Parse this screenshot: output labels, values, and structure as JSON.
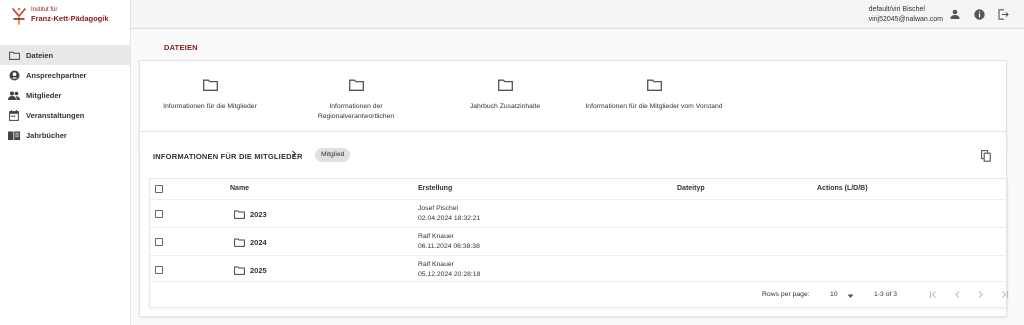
{
  "brand": {
    "line1": "Institut für",
    "line2": "Franz-Kett-Pädagogik"
  },
  "sidebar": {
    "items": [
      {
        "label": "Dateien",
        "icon": "folder-icon",
        "active": true
      },
      {
        "label": "Ansprechpartner",
        "icon": "account-circle-icon"
      },
      {
        "label": "Mitglieder",
        "icon": "people-icon"
      },
      {
        "label": "Veranstaltungen",
        "icon": "calendar-icon"
      },
      {
        "label": "Jahrbücher",
        "icon": "book-icon"
      }
    ]
  },
  "header": {
    "user_name": "default/viri Bischel",
    "user_email": "virij52045@nalwan.com"
  },
  "page": {
    "breadcrumb": "DATEIEN"
  },
  "folders": [
    {
      "label": "Informationen für die Mitglieder"
    },
    {
      "label": "Informationen der Regionalverantwortlichen"
    },
    {
      "label": "Jahrbuch Zusatzinhalte"
    },
    {
      "label": "Informationen für die Mitglieder vom Vorstand"
    }
  ],
  "panel": {
    "title": "INFORMATIONEN FÜR DIE MITGLIEDER",
    "chip": "Mitglied"
  },
  "table": {
    "columns": [
      "Name",
      "Erstellung",
      "Dateityp",
      "Actions (L/D/B)"
    ],
    "rows": [
      {
        "name": "2023",
        "author": "Josef Pischel",
        "date": "02.04.2024 18:32:21"
      },
      {
        "name": "2024",
        "author": "Ralf Knauer",
        "date": "06.11.2024 06:38:38"
      },
      {
        "name": "2025",
        "author": "Ralf Knauer",
        "date": "05.12.2024 20:28:18"
      }
    ]
  },
  "pagination": {
    "rows_per_page_label": "Rows per page:",
    "rows_per_page": "10",
    "range": "1-3 of 3"
  },
  "colors": {
    "brand": "#8b1a1a",
    "active_nav": "#e8e8e8"
  }
}
